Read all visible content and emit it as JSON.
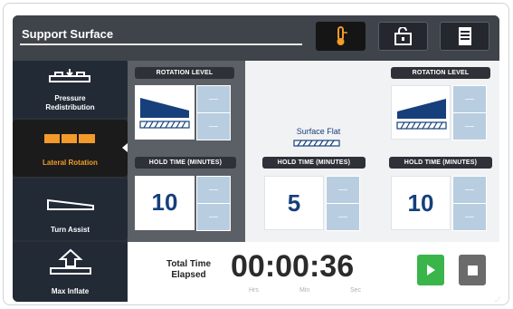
{
  "header": {
    "title": "Support Surface",
    "buttons": [
      {
        "name": "thermometer-icon",
        "active": true
      },
      {
        "name": "unlock-icon",
        "active": false
      },
      {
        "name": "notes-icon",
        "active": false
      }
    ]
  },
  "sidebar": {
    "items": [
      {
        "label": "Pressure Redistribution",
        "icon": "pressure-redistribution-icon",
        "active": false
      },
      {
        "label": "Lateral Rotation",
        "icon": "lateral-rotation-icon",
        "active": true
      },
      {
        "label": "Turn Assist",
        "icon": "turn-assist-icon",
        "active": false
      },
      {
        "label": "Max Inflate",
        "icon": "max-inflate-icon",
        "active": false
      }
    ]
  },
  "left_panel": {
    "rotation_label": "ROTATION LEVEL",
    "hold_label": "HOLD TIME (MINUTES)",
    "hold_value": "10"
  },
  "center_panel": {
    "surface_label": "Surface Flat",
    "hold_label": "HOLD TIME (MINUTES)",
    "hold_value": "5"
  },
  "right_panel": {
    "rotation_label": "ROTATION LEVEL",
    "hold_label": "HOLD TIME (MINUTES)",
    "hold_value": "10"
  },
  "footer": {
    "elapsed_label": "Total Time Elapsed",
    "timer": "00:00:36",
    "units": {
      "hrs": "Hrs",
      "min": "Min",
      "sec": "Sec"
    },
    "play_icon": "play-icon",
    "stop_icon": "stop-icon"
  },
  "colors": {
    "active_orange": "#f39a2a",
    "value_blue": "#163f7c",
    "play_green": "#39b54a"
  }
}
